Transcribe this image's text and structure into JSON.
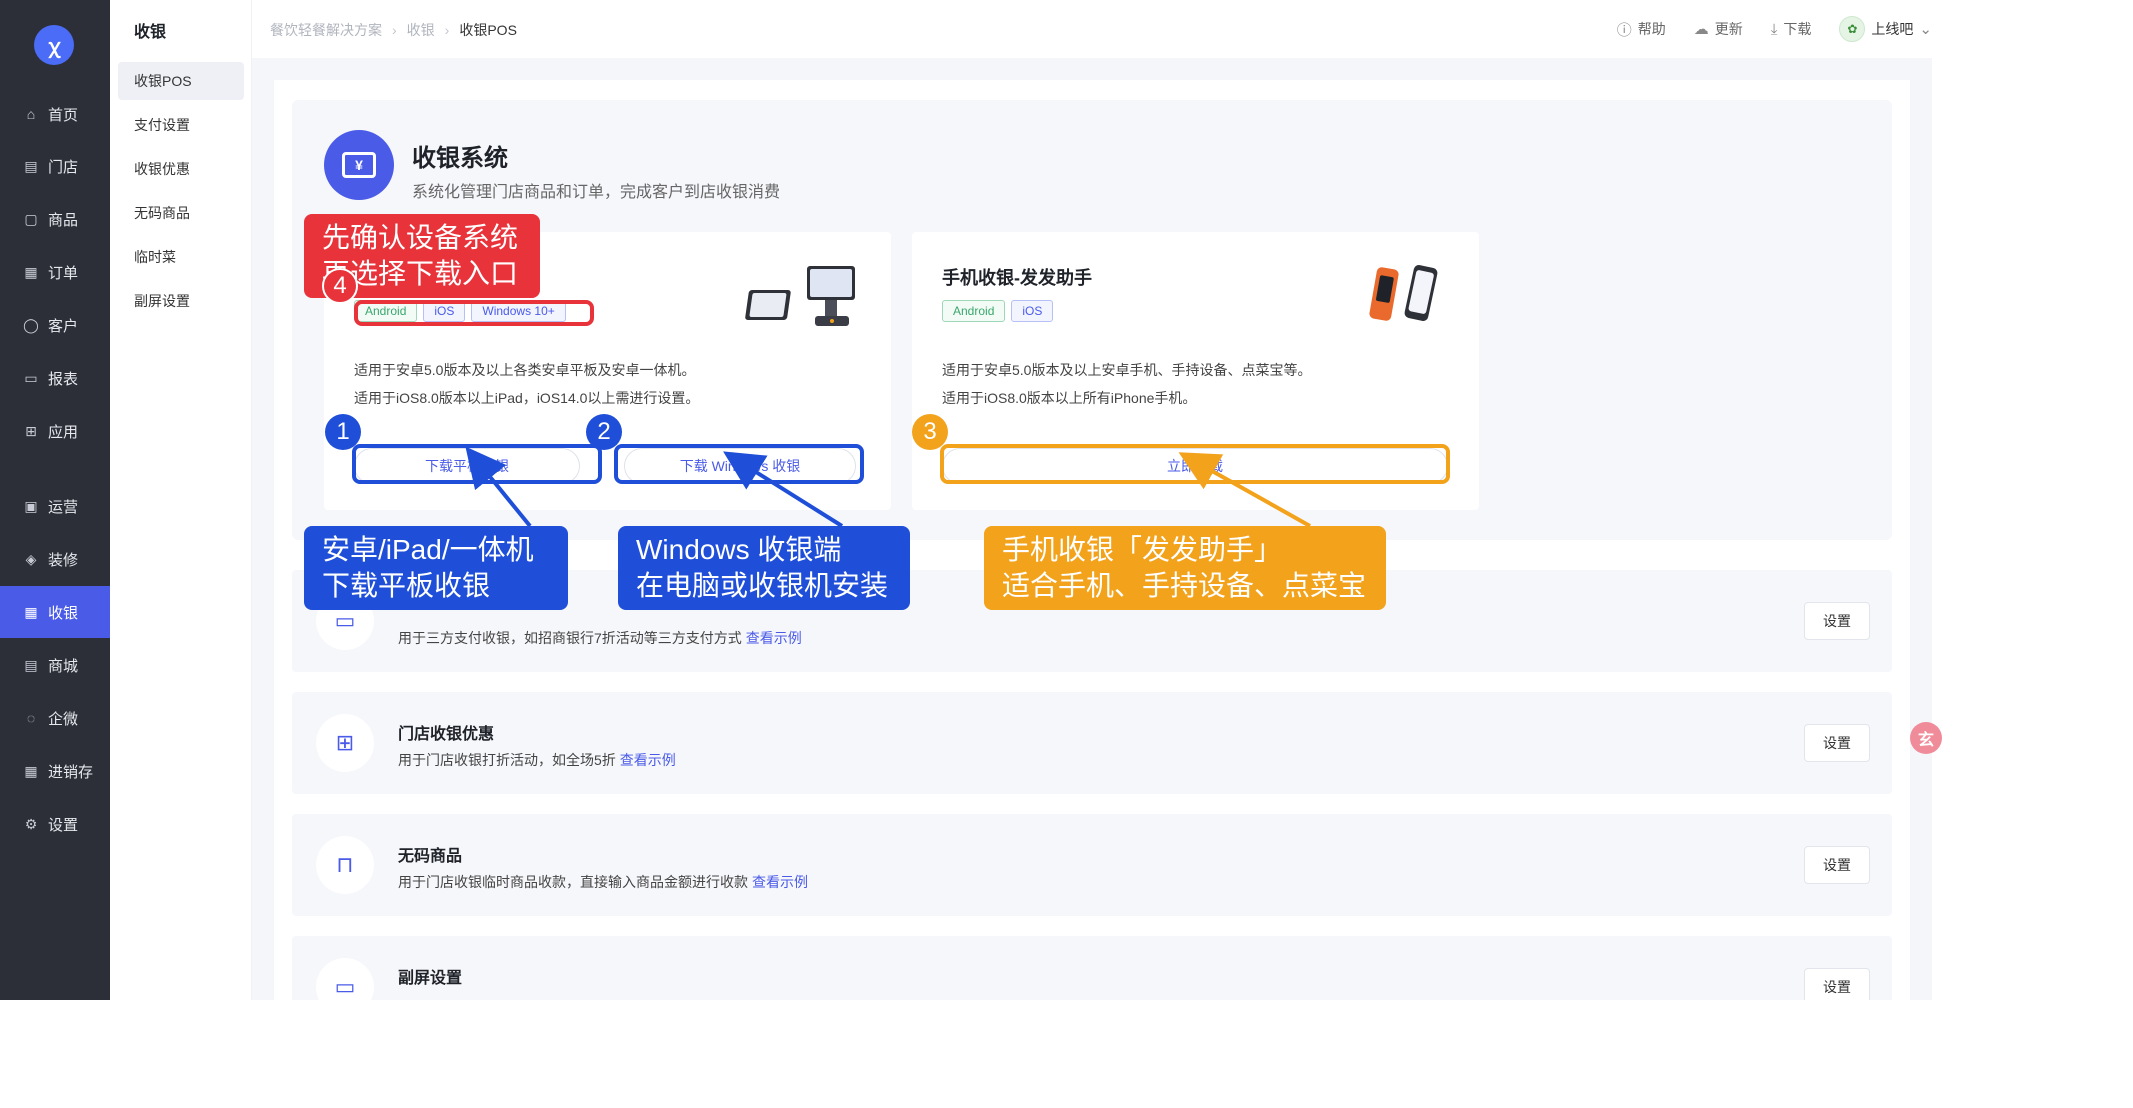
{
  "nav": {
    "items": [
      {
        "label": "首页",
        "icon": "home-icon",
        "glyph": "⌂"
      },
      {
        "label": "门店",
        "icon": "store-icon",
        "glyph": "▤"
      },
      {
        "label": "商品",
        "icon": "goods-icon",
        "glyph": "▢"
      },
      {
        "label": "订单",
        "icon": "order-icon",
        "glyph": "▦"
      },
      {
        "label": "客户",
        "icon": "customer-icon",
        "glyph": "◯"
      },
      {
        "label": "报表",
        "icon": "report-icon",
        "glyph": "▭"
      },
      {
        "label": "应用",
        "icon": "apps-icon",
        "glyph": "⊞"
      },
      {
        "label": "运营",
        "icon": "operation-icon",
        "glyph": "▣"
      },
      {
        "label": "装修",
        "icon": "decoration-icon",
        "glyph": "◈"
      },
      {
        "label": "收银",
        "icon": "cashier-icon",
        "glyph": "▦"
      },
      {
        "label": "商城",
        "icon": "mall-icon",
        "glyph": "▤"
      },
      {
        "label": "企微",
        "icon": "wecom-icon",
        "glyph": "◌"
      },
      {
        "label": "进销存",
        "icon": "inventory-icon",
        "glyph": "▦"
      },
      {
        "label": "设置",
        "icon": "settings-icon",
        "glyph": "⚙"
      }
    ],
    "active": "收银"
  },
  "subnav": {
    "title": "收银",
    "items": [
      "收银POS",
      "支付设置",
      "收银优惠",
      "无码商品",
      "临时菜",
      "副屏设置"
    ],
    "active": "收银POS"
  },
  "header": {
    "breadcrumb": [
      "餐饮轻餐解决方案",
      "收银",
      "收银POS"
    ],
    "help": "帮助",
    "update": "更新",
    "download": "下载",
    "account": "上线吧"
  },
  "hero": {
    "title": "收银系统",
    "desc": "系统化管理门店商品和订单，完成客户到店收银消费"
  },
  "card1": {
    "tags": [
      "Android",
      "iOS",
      "Windows 10+"
    ],
    "line1": "适用于安卓5.0版本及以上各类安卓平板及安卓一体机。",
    "line2": "适用于iOS8.0版本以上iPad，iOS14.0以上需进行设置。",
    "btn_tablet": "下载平板收银",
    "btn_windows": "下载 Windows 收银"
  },
  "card2": {
    "title": "手机收银-发发助手",
    "tags": [
      "Android",
      "iOS"
    ],
    "line1": "适用于安卓5.0版本及以上安卓手机、手持设备、点菜宝等。",
    "line2": "适用于iOS8.0版本以上所有iPhone手机。",
    "btn_download": "立即下载"
  },
  "rows": [
    {
      "title": "",
      "desc": "用于三方支付收银，如招商银行7折活动等三方支付方式",
      "link": "查看示例",
      "btn": "设置",
      "icon": "payment-icon",
      "glyph": "▭"
    },
    {
      "title": "门店收银优惠",
      "desc": "用于门店收银打折活动，如全场5折",
      "link": "查看示例",
      "btn": "设置",
      "icon": "gift-icon",
      "glyph": "⊞"
    },
    {
      "title": "无码商品",
      "desc": "用于门店收银临时商品收款，直接输入商品金额进行收款",
      "link": "查看示例",
      "btn": "设置",
      "icon": "bag-icon",
      "glyph": "⊓"
    },
    {
      "title": "副屏设置",
      "desc": "",
      "link": "",
      "btn": "设置",
      "icon": "monitor-icon",
      "glyph": "▭"
    }
  ],
  "annotations": {
    "num1": "1",
    "num2": "2",
    "num3": "3",
    "num4": "4",
    "callout1": [
      "安卓/iPad/一体机",
      "下载平板收银"
    ],
    "callout2": [
      "Windows 收银端",
      "在电脑或收银机安装"
    ],
    "callout3": [
      "手机收银「发发助手」",
      "适合手机、手持设备、点菜宝"
    ],
    "callout4": [
      "先确认设备系统",
      "再选择下载入口"
    ]
  },
  "colors": {
    "accent": "#4a5be8",
    "nav_bg": "#2d2f38",
    "annotation_blue": "#1f4fd8",
    "annotation_orange": "#f2a21b",
    "annotation_red": "#e8333b"
  }
}
